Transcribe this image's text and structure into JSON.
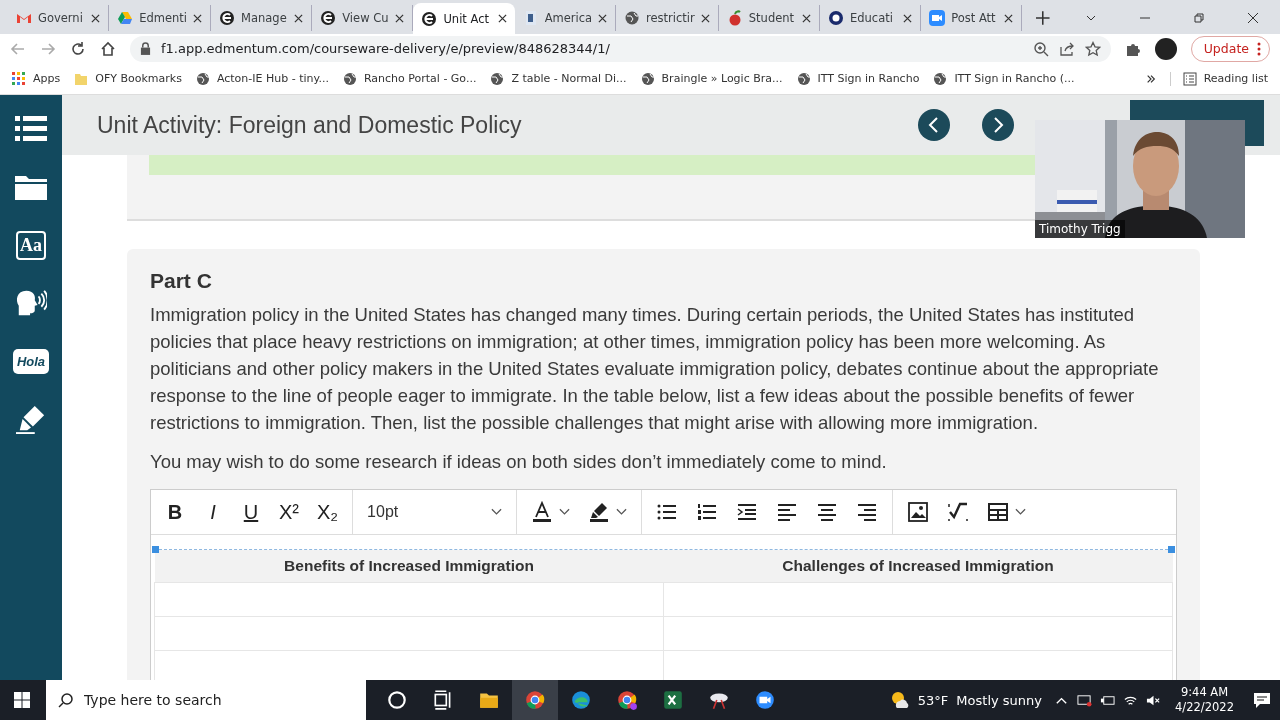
{
  "browser": {
    "tabs": [
      {
        "label": "Governi",
        "kind": "mail",
        "selected": false
      },
      {
        "label": "Edmenti",
        "kind": "triangle",
        "selected": false
      },
      {
        "label": "Manage",
        "kind": "letter",
        "selected": false
      },
      {
        "label": "View Cu",
        "kind": "letter",
        "selected": false
      },
      {
        "label": "Unit Act",
        "kind": "letter",
        "selected": true
      },
      {
        "label": "America",
        "kind": "document",
        "selected": false
      },
      {
        "label": "restrictir",
        "kind": "globe",
        "selected": false
      },
      {
        "label": "Student",
        "kind": "apple",
        "selected": false
      },
      {
        "label": "Educati",
        "kind": "ring",
        "selected": false
      },
      {
        "label": "Post Att",
        "kind": "camera",
        "selected": false
      }
    ],
    "address": "f1.app.edmentum.com/courseware-delivery/e/preview/848628344/1/",
    "update_button": "Update",
    "bookmarks": [
      {
        "label": "Apps",
        "kind": "grid"
      },
      {
        "label": "OFY Bookmarks",
        "kind": "folder"
      },
      {
        "label": "Acton-IE Hub - tiny...",
        "kind": "globe"
      },
      {
        "label": "Rancho Portal - Go...",
        "kind": "globe"
      },
      {
        "label": "Z table - Normal Di...",
        "kind": "globe"
      },
      {
        "label": "Braingle » Logic Bra...",
        "kind": "globe"
      },
      {
        "label": "ITT Sign in Rancho",
        "kind": "globe"
      },
      {
        "label": "ITT Sign in Rancho (...",
        "kind": "globe"
      }
    ],
    "reading_list": "Reading list"
  },
  "sidebar": {
    "items": [
      {
        "kind": "list"
      },
      {
        "kind": "folder"
      },
      {
        "kind": "text",
        "label": "Aa"
      },
      {
        "kind": "speech"
      },
      {
        "kind": "bubble",
        "label": "Hola"
      },
      {
        "kind": "pen"
      }
    ]
  },
  "header": {
    "title": "Unit Activity: Foreign and Domestic Policy"
  },
  "part": {
    "heading": "Part C",
    "paragraphs": [
      "Immigration policy in the United States has changed many times. During certain periods, the United States has instituted policies that place heavy restrictions on immigration; at other times, immigration policy has been more welcoming. As politicians and other policy makers in the United States evaluate immigration policy, debates continue about the appropriate response to the line of people eager to immigrate. In the table below, list a few ideas about the possible benefits of fewer restrictions to immigration. Then, list the possible challenges that might arise with allowing more immigration.",
      "You may wish to do some research if ideas on both sides don’t immediately come to mind."
    ],
    "editor": {
      "format_buttons": [
        "B",
        "I",
        "U",
        "X²",
        "X₂"
      ],
      "font_size": "10pt",
      "table": {
        "columns": [
          "Benefits of Increased Immigration",
          "Challenges of Increased Immigration"
        ]
      }
    }
  },
  "video": {
    "name": "Timothy Trigg"
  },
  "taskbar": {
    "search_placeholder": "Type here to search",
    "temperature": "53°F",
    "weather": "Mostly sunny",
    "time": "9:44 AM",
    "date": "4/22/2022"
  }
}
